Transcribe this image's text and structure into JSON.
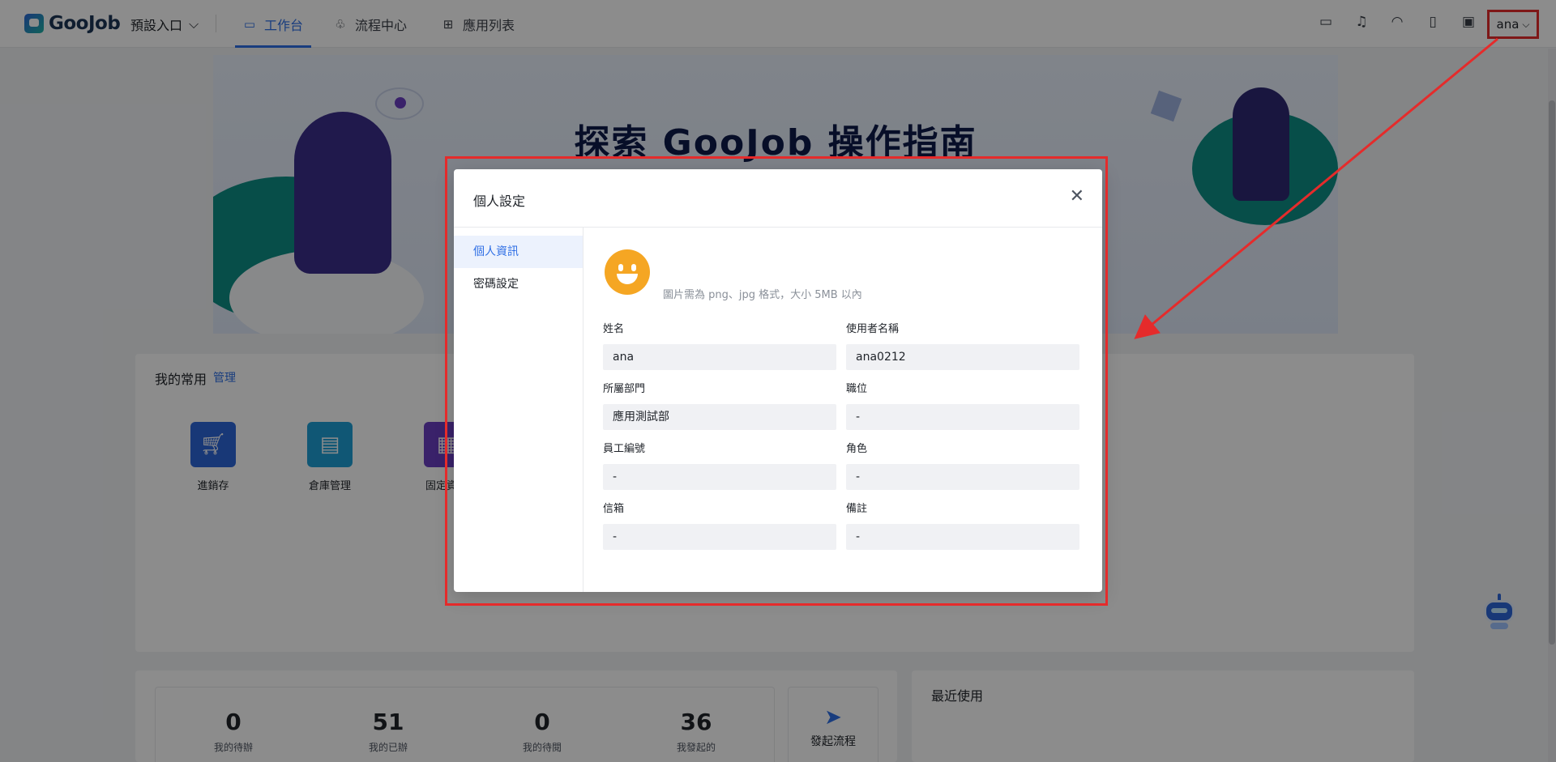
{
  "brand": {
    "logo_text": "GooJob"
  },
  "topbar": {
    "entry_label": "預設入口",
    "tabs": [
      {
        "label": "工作台",
        "icon": "monitor-icon",
        "active": true
      },
      {
        "label": "流程中心",
        "icon": "flow-icon",
        "active": false
      },
      {
        "label": "應用列表",
        "icon": "grid-icon",
        "active": false
      }
    ],
    "icons": [
      "desktop-icon",
      "bell-icon",
      "headset-icon",
      "book-icon",
      "image-add-icon"
    ],
    "user_name": "ana"
  },
  "banner": {
    "title": "探索 GooJob 操作指南"
  },
  "favorites": {
    "title": "我的常用",
    "manage_label": "管理",
    "apps": [
      {
        "label": "進銷存",
        "icon": "cart-icon",
        "color": "#2d66d9"
      },
      {
        "label": "倉庫管理",
        "icon": "store-icon",
        "color": "#1e9fd6"
      },
      {
        "label": "固定資產",
        "icon": "blocks-icon",
        "color": "#6a3fc2"
      }
    ]
  },
  "stats": [
    {
      "value": "0",
      "label": "我的待辦"
    },
    {
      "value": "51",
      "label": "我的已辦"
    },
    {
      "value": "0",
      "label": "我的待閱"
    },
    {
      "value": "36",
      "label": "我發起的"
    }
  ],
  "launch": {
    "label": "發起流程",
    "icon": "paper-plane-icon"
  },
  "recent": {
    "title": "最近使用"
  },
  "modal": {
    "title": "個人設定",
    "close_icon": "close-icon",
    "side_items": [
      {
        "label": "個人資訊",
        "active": true
      },
      {
        "label": "密碼設定",
        "active": false
      }
    ],
    "avatar_hint": "圖片需為 png、jpg 格式，大小 5MB 以內",
    "fields": [
      {
        "label": "姓名",
        "value": "ana"
      },
      {
        "label": "使用者名稱",
        "value": "ana0212"
      },
      {
        "label": "所屬部門",
        "value": "應用測試部"
      },
      {
        "label": "職位",
        "value": "-"
      },
      {
        "label": "員工編號",
        "value": "-"
      },
      {
        "label": "角色",
        "value": "-"
      },
      {
        "label": "信箱",
        "value": "-"
      },
      {
        "label": "備註",
        "value": "-"
      }
    ]
  },
  "colors": {
    "accent": "#2f6fe5",
    "annotation": "#e52b2b",
    "avatar": "#f5a623"
  }
}
